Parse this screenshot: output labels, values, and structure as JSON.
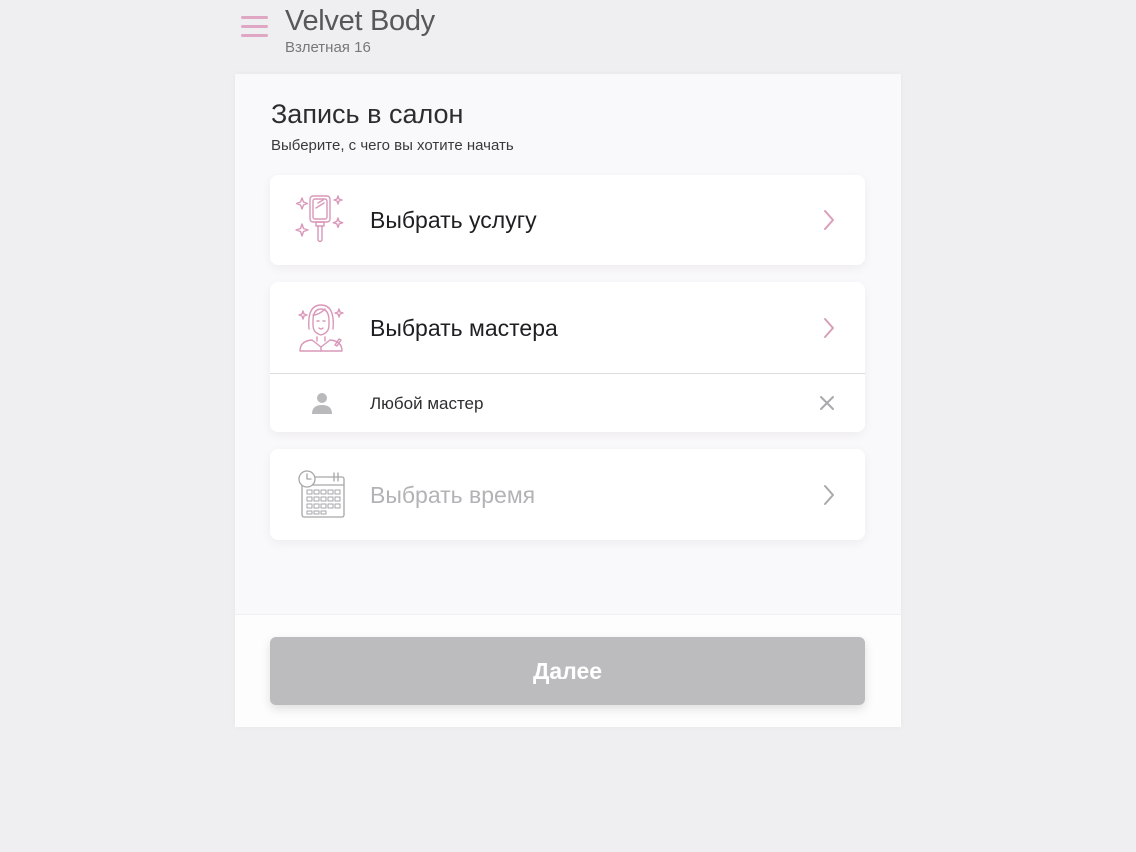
{
  "header": {
    "salon_name": "Velvet Body",
    "address": "Взлетная 16"
  },
  "booking": {
    "title": "Запись в салон",
    "subtitle": "Выберите, с чего вы хотите начать",
    "choose_service": "Выбрать услугу",
    "choose_master": "Выбрать мастера",
    "selected_master": "Любой мастер",
    "choose_time": "Выбрать время",
    "next_button": "Далее"
  },
  "icons": {
    "menu": "hamburger-menu-icon",
    "service": "hand-mirror-icon",
    "master": "stylist-woman-icon",
    "time": "calendar-clock-icon",
    "chevron": "chevron-right-icon",
    "person": "person-icon",
    "clear": "close-icon"
  },
  "colors": {
    "accent": "#e0a7c4",
    "disabled_button": "#bcbbbe",
    "disabled_text": "#b3b3b6"
  }
}
